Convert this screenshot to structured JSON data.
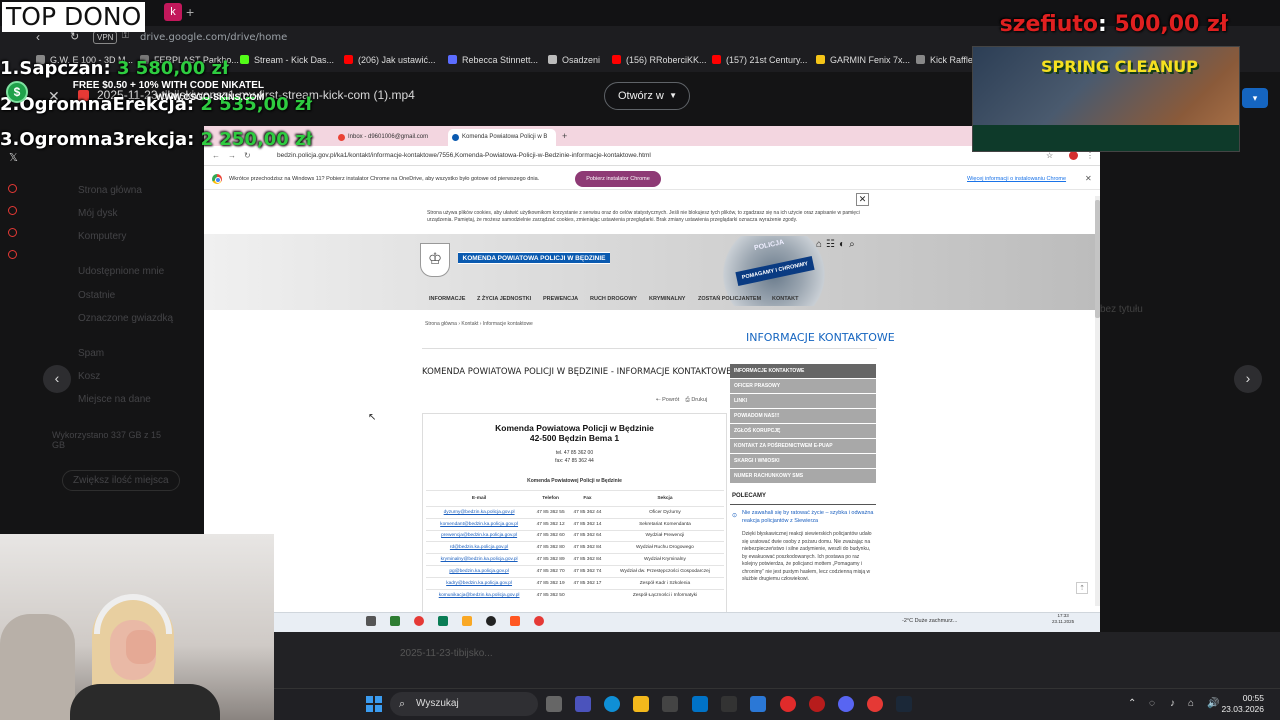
{
  "overlay": {
    "top_dono": "TOP DONO",
    "donors": [
      {
        "rank": "1.",
        "name": "Sapczan:",
        "amount": "3 580,00 zł"
      },
      {
        "rank": "2.",
        "name": "OgromnaErekcja:",
        "amount": "2 535,00 zł"
      },
      {
        "rank": "3.",
        "name": "Ogromna3rekcja:",
        "amount": "2 250,00 zł"
      }
    ],
    "top_donor": {
      "name": "szefiuto",
      "amount": "500,00 zł"
    },
    "ad": {
      "title": "SPRING CLEANUP",
      "line1": "FREE $0.50 + 10% WITH CODE NIKATEL",
      "line2": "WWW.CSGO-SKINS.COM"
    }
  },
  "outer_browser": {
    "vpn": "VPN",
    "url": "drive.google.com/drive/home",
    "bookmarks": [
      {
        "label": "G.W. E 100 - 3D M...",
        "color": "#888888"
      },
      {
        "label": "FERPLAST Parkho...",
        "color": "#777777"
      },
      {
        "label": "Stream - Kick Das...",
        "color": "#53fc18"
      },
      {
        "label": "(206) Jak ustawić...",
        "color": "#ff0000"
      },
      {
        "label": "Rebecca Stinnett...",
        "color": "#5b6cff"
      },
      {
        "label": "Osadzeni",
        "color": "#bbbbbb"
      },
      {
        "label": "(156) RRoberciKK...",
        "color": "#ff0000"
      },
      {
        "label": "(157) 21st Century...",
        "color": "#ff0000"
      },
      {
        "label": "GARMIN Fenix 7x...",
        "color": "#f5c518"
      },
      {
        "label": "Kick Raffle",
        "color": "#888888"
      }
    ]
  },
  "drive": {
    "file_name": "2025-11-23-tibijskiwonsz1-my-first-stream-kick-com (1).mp4",
    "open_with": "Otwórz w",
    "sidebar": [
      "Strona główna",
      "Mój dysk",
      "Komputery",
      "Udostępnione mnie",
      "Ostatnie",
      "Oznaczone gwiazdką",
      "Spam",
      "Kosz",
      "Miejsce na dane"
    ],
    "storage": "Wykorzystano 337 GB z 15 GB",
    "storage_button": "Zwiększ ilość miejsca",
    "right_text": "bez tytułu",
    "bottom_row": "2025-11-23-tibijsko..."
  },
  "inner_browser": {
    "tabs": [
      {
        "label": "Inbox - d9601006@gmail.com",
        "dot": "#ea4335"
      },
      {
        "label": "Komenda Powiatowa Policji w B",
        "dot": "#0a5ab0"
      }
    ],
    "url": "bedzin.policja.gov.pl/ka1/kontakt/informacje-kontaktowe/7556,Komenda-Powiatowa-Policji-w-Bedzinie-informacje-kontaktowe.html",
    "info_text": "Wkrótce przechodzisz na Windows 11? Pobierz instalator Chrome na OneDrive, aby wszystko było gotowe od pierwszego dnia.",
    "info_button": "Pobierz instalator Chrome",
    "info_link": "Więcej informacji o instalowaniu Chrome",
    "cookie_text": "Strona używa plików cookies, aby ułatwić użytkownikom korzystanie z serwisu oraz do celów statystycznych. Jeśli nie blokujesz tych plików, to zgadzasz się na ich użycie oraz zapisanie w pamięci urządzenia. Pamiętaj, że możesz samodzielnie zarządzać cookies, zmieniając ustawienia przeglądarki. Brak zmiany ustawienia przeglądarki oznacza wyrażenie zgody.",
    "site_name": "KOMENDA POWIATOWA POLICJI W BĘDZINIE",
    "badge_text": "POMAGAMY I CHRONIMY",
    "badge_word": "POLICJA",
    "nav": [
      "INFORMACJE",
      "Z ŻYCIA JEDNOSTKI",
      "PREWENCJA",
      "RUCH DROGOWY",
      "KRYMINALNY",
      "ZOSTAŃ POLICJANTEM",
      "KONTAKT"
    ],
    "breadcrumb": "Strona główna › Kontakt › Informacje kontaktowe",
    "page_heading": "INFORMACJE KONTAKTOWE",
    "main_title": "KOMENDA POWIATOWA POLICJI W BĘDZINIE - INFORMACJE KONTAKTOWE",
    "back": "⇠ Powrót",
    "print": "⎙ Drukuj",
    "card": {
      "title": "Komenda Powiatowa Policji w Będzinie",
      "address": "42-500 Będzin Bema 1",
      "tel": "tel.   47 85 362 00",
      "fax": "fax:   47 85 362 44",
      "subtitle": "Komenda Powiatowej   Policji w Będzinie",
      "headers": [
        "E-mail",
        "Telefon",
        "Fax",
        "Sekcja"
      ],
      "rows": [
        [
          "dyzurny@bedzin.ka.policja.gov.pl",
          "47 85 362 55",
          "47 85 362 44",
          "Oficer Dyżurny"
        ],
        [
          "komendant@bedzin.ka.policja.gov.pl",
          "47 85 362 12",
          "47 85 362 14",
          "Sekretariat Komendanta"
        ],
        [
          "prewencja@bedzin.ka.policja.gov.pl",
          "47 85 362 60",
          "47 85 362 64",
          "Wydział Prewencji"
        ],
        [
          "rd@bedzin.ka.policja.gov.pl",
          "47 85 362 80",
          "47 85 362 84",
          "Wydział Ruchu Drogowego"
        ],
        [
          "kryminalny@bedzin.ka.policja.gov.pl",
          "47 85 362 89",
          "47 85 362 84",
          "Wydział Kryminalny"
        ],
        [
          "pg@bedzin.ka.policja.gov.pl",
          "47 85 362 70",
          "47 85 362 74",
          "Wydział dw. Przestępczości Gospodarczej"
        ],
        [
          "kadry@bedzin.ka.policja.gov.pl",
          "47 85 362 19",
          "47 85 362 17",
          "Zespół Kadr i Szkolenia"
        ],
        [
          "komunikacja@bedzin.ka.policja.gov.pl",
          "47 85 362 50",
          "",
          "Zespół Łączności i Informatyki"
        ]
      ]
    },
    "side_menu": [
      "INFORMACJE KONTAKTOWE",
      "OFICER PRASOWY",
      "LINKI",
      "POWIADOM NAS!!!",
      "ZGŁOŚ KORUPCJĘ",
      "KONTAKT ZA POŚREDNICTWEM E-PUAP",
      "SKARGI I WNIOSKI",
      "NUMER RACHUNKOWY SMS"
    ],
    "recommended_heading": "POLECAMY",
    "recommended_link": "Nie zawahali się by ratować życie – szybka i odważna reakcja policjantów z Siewierza",
    "recommended_text": "Dzięki błyskawicznej reakcji siewierskich policjantów udało się uratować dwie osoby z pożaru domu. Nie zważając na niebezpieczeństwo i silne zadymienie, weszli do budynku, by ewakuować poszkodowanych. Ich postawa po raz kolejny potwierdza, że policjanci mottem „Pomagamy i chronimy” nie jest pustym hasłem, lecz codzienną misją w służbie drugiemu człowiekowi.",
    "weather": "-2°C  Duże zachmurz...",
    "clock_time": "17:33",
    "clock_date": "23.11.2025"
  },
  "taskbar": {
    "search_label": "Wyszukaj",
    "time": "00:55",
    "date": "23.03.2026"
  }
}
